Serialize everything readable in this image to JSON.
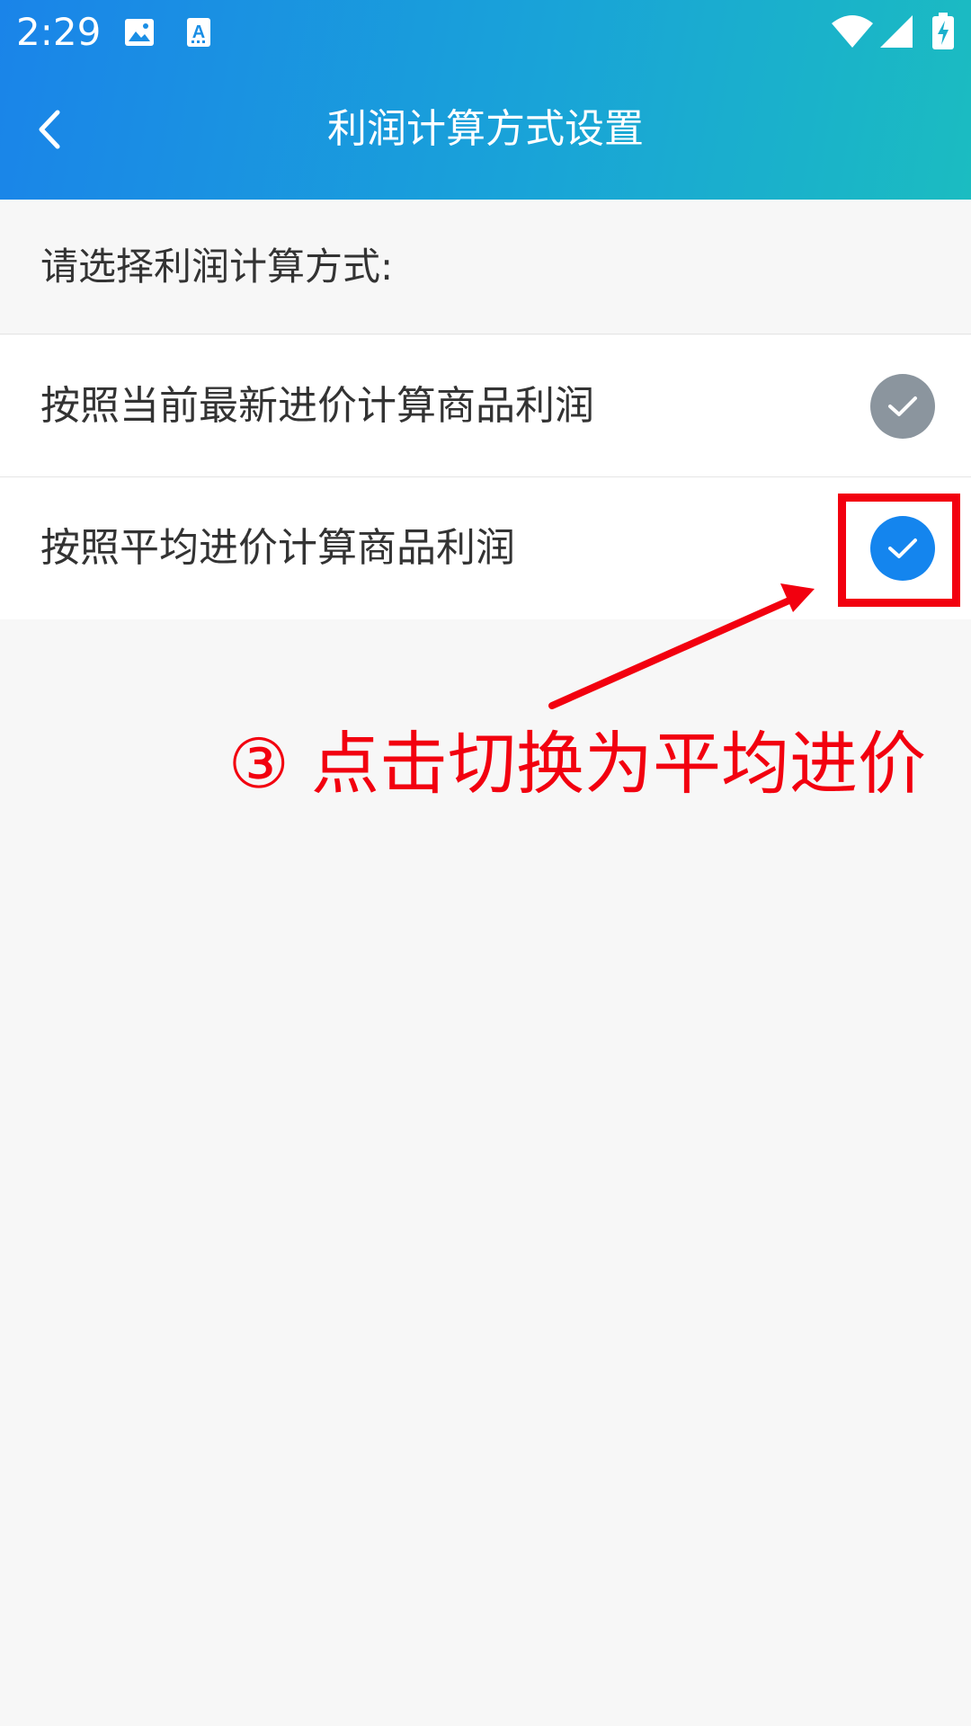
{
  "status_bar": {
    "time": "2:29",
    "icons": [
      "image-icon",
      "text-a-icon",
      "wifi-icon",
      "signal-icon",
      "battery-charging-icon"
    ]
  },
  "app_bar": {
    "title": "利润计算方式设置",
    "back_icon": "chevron-left-icon"
  },
  "prompt": "请选择利润计算方式:",
  "options": [
    {
      "label": "按照当前最新进价计算商品利润",
      "selected": false,
      "check_color": "#8b959e"
    },
    {
      "label": "按照平均进价计算商品利润",
      "selected": true,
      "check_color": "#1485ee"
    }
  ],
  "annotation": {
    "text": "③ 点击切换为平均进价",
    "color": "#f2000f"
  },
  "colors": {
    "header_start": "#1a84e9",
    "header_end": "#1bbcc1",
    "background": "#f7f7f7"
  }
}
